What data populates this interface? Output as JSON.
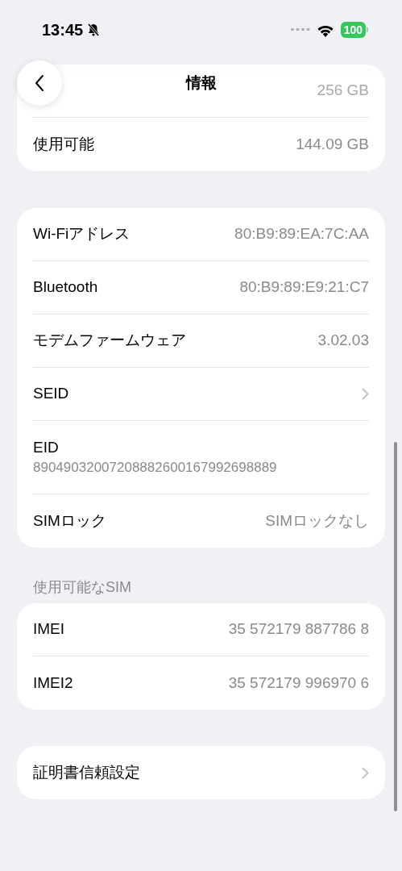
{
  "status_bar": {
    "time": "13:45",
    "silent": true,
    "battery": "100"
  },
  "nav": {
    "title": "情報"
  },
  "groups": [
    {
      "rows": [
        {
          "kind": "faded",
          "value": "256 GB"
        },
        {
          "kind": "value",
          "label": "使用可能",
          "value": "144.09 GB"
        }
      ]
    },
    {
      "rows": [
        {
          "kind": "value",
          "label": "Wi-Fiアドレス",
          "value": "80:B9:89:EA:7C:AA"
        },
        {
          "kind": "value",
          "label": "Bluetooth",
          "value": "80:B9:89:E9:21:C7"
        },
        {
          "kind": "value",
          "label": "モデムファームウェア",
          "value": "3.02.03"
        },
        {
          "kind": "link",
          "label": "SEID"
        },
        {
          "kind": "stacked",
          "label": "EID",
          "value": "89049032007208882600167992698889"
        },
        {
          "kind": "value",
          "label": "SIMロック",
          "value": "SIMロックなし"
        }
      ]
    },
    {
      "header": "使用可能なSIM",
      "rows": [
        {
          "kind": "value",
          "label": "IMEI",
          "value": "35 572179 887786 8"
        },
        {
          "kind": "value",
          "label": "IMEI2",
          "value": "35 572179 996970 6"
        }
      ]
    },
    {
      "rows": [
        {
          "kind": "link",
          "label": "証明書信頼設定"
        }
      ]
    }
  ]
}
